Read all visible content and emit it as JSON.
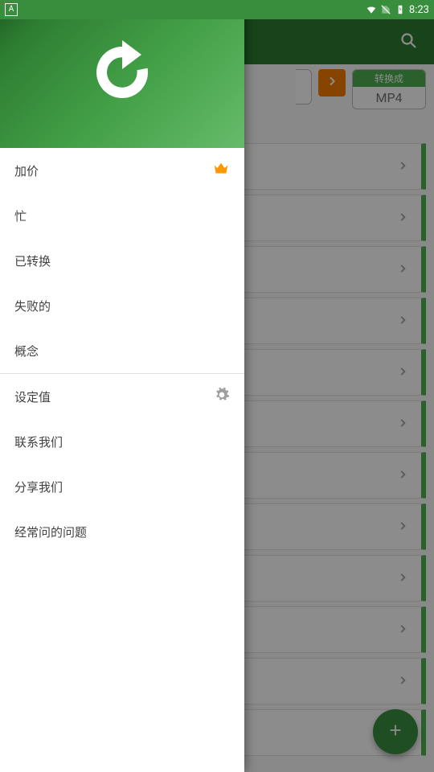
{
  "status": {
    "time": "8:23",
    "left_badge": "A"
  },
  "appbar": {
    "search_label": "search"
  },
  "chips": {
    "convert_label": "转换成",
    "target_format": "MP4"
  },
  "drawer": {
    "items": [
      {
        "label": "加价",
        "icon": "crown"
      },
      {
        "label": "忙",
        "icon": null
      },
      {
        "label": "已转换",
        "icon": null
      },
      {
        "label": "失败的",
        "icon": null
      },
      {
        "label": "概念",
        "icon": null
      },
      {
        "label": "设定值",
        "icon": "gear",
        "divider_before": true
      },
      {
        "label": "联系我们",
        "icon": null
      },
      {
        "label": "分享我们",
        "icon": null
      },
      {
        "label": "经常问的问题",
        "icon": null
      }
    ]
  },
  "list": {
    "visible_count": 12
  },
  "fab": {
    "label": "add"
  }
}
